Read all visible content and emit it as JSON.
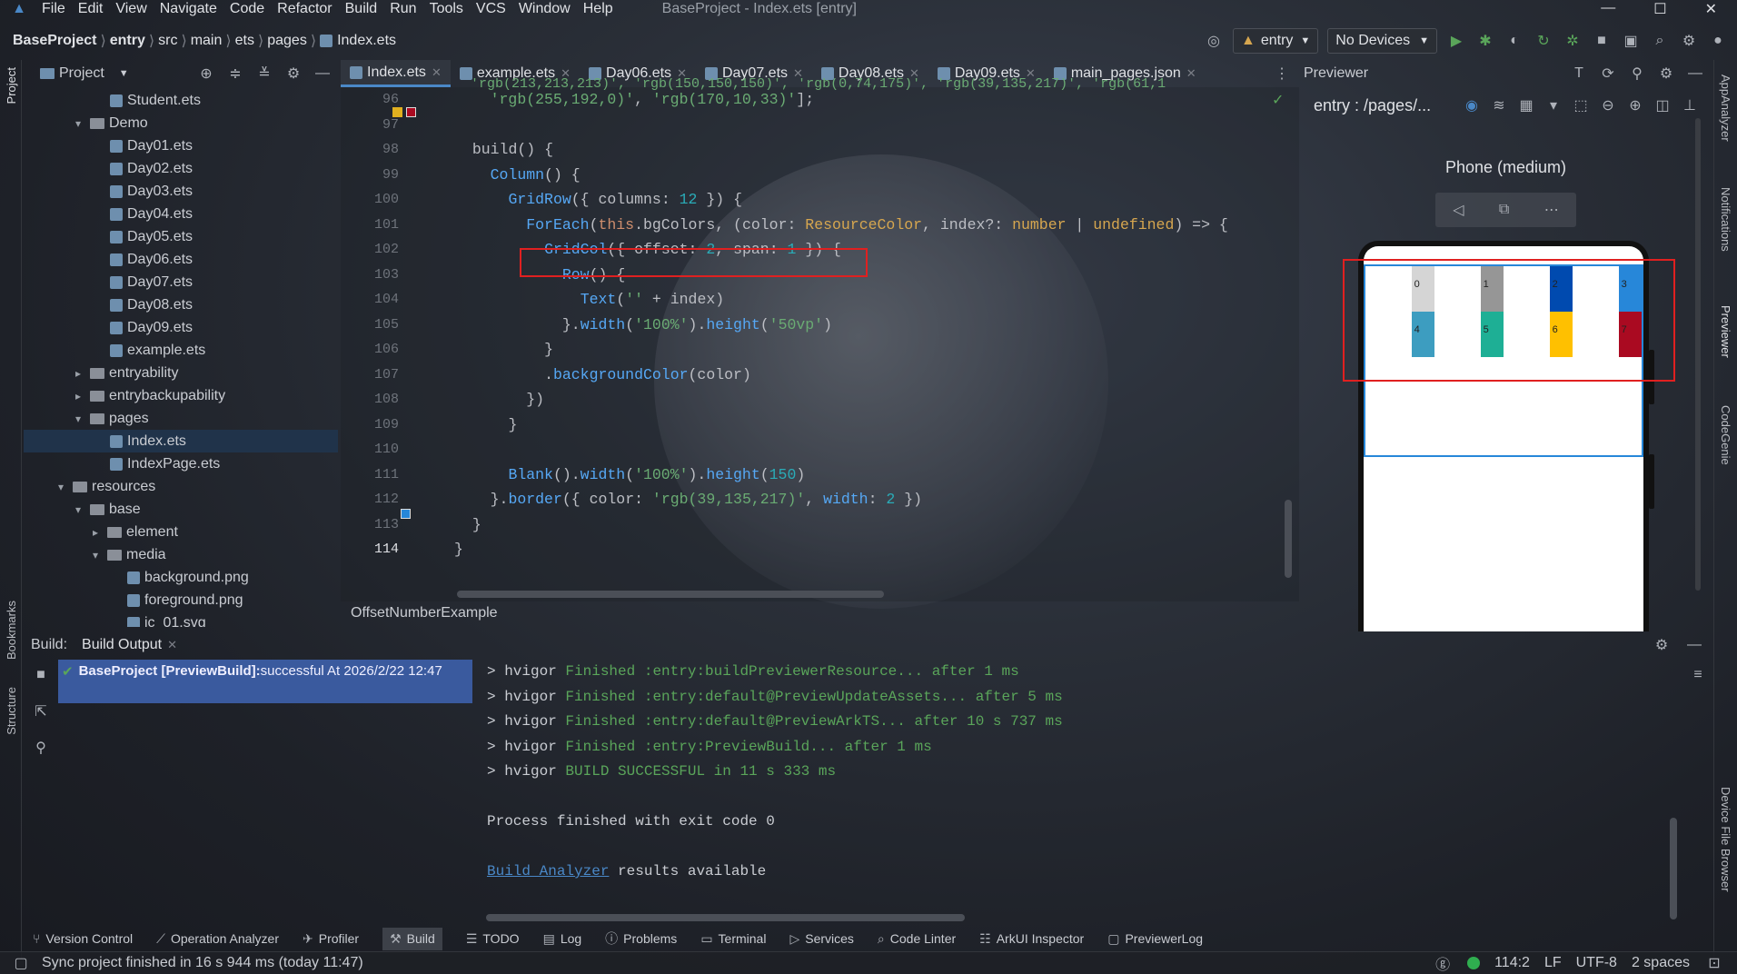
{
  "menu": [
    "File",
    "Edit",
    "View",
    "Navigate",
    "Code",
    "Refactor",
    "Build",
    "Run",
    "Tools",
    "VCS",
    "Window",
    "Help"
  ],
  "window_title": "BaseProject - Index.ets [entry]",
  "breadcrumb": [
    "BaseProject",
    "entry",
    "src",
    "main",
    "ets",
    "pages",
    "Index.ets"
  ],
  "toolbar": {
    "config": "entry",
    "devices": "No Devices"
  },
  "project": {
    "title": "Project",
    "tree": [
      {
        "label": "Student.ets",
        "indent": 7,
        "kind": "file"
      },
      {
        "label": "Demo",
        "indent": 5,
        "kind": "folder",
        "arrow": "v"
      },
      {
        "label": "Day01.ets",
        "indent": 7,
        "kind": "file"
      },
      {
        "label": "Day02.ets",
        "indent": 7,
        "kind": "file"
      },
      {
        "label": "Day03.ets",
        "indent": 7,
        "kind": "file"
      },
      {
        "label": "Day04.ets",
        "indent": 7,
        "kind": "file"
      },
      {
        "label": "Day05.ets",
        "indent": 7,
        "kind": "file"
      },
      {
        "label": "Day06.ets",
        "indent": 7,
        "kind": "file"
      },
      {
        "label": "Day07.ets",
        "indent": 7,
        "kind": "file"
      },
      {
        "label": "Day08.ets",
        "indent": 7,
        "kind": "file"
      },
      {
        "label": "Day09.ets",
        "indent": 7,
        "kind": "file"
      },
      {
        "label": "example.ets",
        "indent": 7,
        "kind": "file"
      },
      {
        "label": "entryability",
        "indent": 5,
        "kind": "folder",
        "arrow": ">"
      },
      {
        "label": "entrybackupability",
        "indent": 5,
        "kind": "folder",
        "arrow": ">"
      },
      {
        "label": "pages",
        "indent": 5,
        "kind": "folder",
        "arrow": "v"
      },
      {
        "label": "Index.ets",
        "indent": 7,
        "kind": "file",
        "selected": true
      },
      {
        "label": "IndexPage.ets",
        "indent": 7,
        "kind": "file"
      },
      {
        "label": "resources",
        "indent": 4,
        "kind": "folder",
        "arrow": "v"
      },
      {
        "label": "base",
        "indent": 5,
        "kind": "folder",
        "arrow": "v"
      },
      {
        "label": "element",
        "indent": 6,
        "kind": "folder",
        "arrow": ">"
      },
      {
        "label": "media",
        "indent": 6,
        "kind": "folder",
        "arrow": "v"
      },
      {
        "label": "background.png",
        "indent": 8,
        "kind": "file"
      },
      {
        "label": "foreground.png",
        "indent": 8,
        "kind": "file"
      },
      {
        "label": "ic_01.svg",
        "indent": 8,
        "kind": "file"
      }
    ]
  },
  "tabs": [
    "Index.ets",
    "example.ets",
    "Day06.ets",
    "Day07.ets",
    "Day08.ets",
    "Day09.ets",
    "main_pages.json"
  ],
  "line_numbers": [
    "96",
    "97",
    "98",
    "99",
    "100",
    "101",
    "102",
    "103",
    "104",
    "105",
    "106",
    "107",
    "108",
    "109",
    "110",
    "111",
    "112",
    "113",
    "114"
  ],
  "code_lines": [
    "    'rgb(255,192,0)', 'rgb(170,10,33)'];",
    "",
    "  build() {",
    "    Column() {",
    "      GridRow({ columns: 12 }) {",
    "        ForEach(this.bgColors, (color: ResourceColor, index?: number | undefined) => {",
    "          GridCol({ offset: 2, span: 1 }) {",
    "            Row() {",
    "              Text('' + index)",
    "            }.width('100%').height('50vp')",
    "          }",
    "          .backgroundColor(color)",
    "        })",
    "      }",
    "",
    "      Blank().width('100%').height(150)",
    "    }.border({ color: 'rgb(39,135,217)', width: 2 })",
    "  }",
    "}"
  ],
  "code_top_partial": "  'rgb(213,213,213)', 'rgb(150,150,150)', 'rgb(0,74,175)', 'rgb(39,135,217)', 'rgb(61,1",
  "code_breadcrumb": "OffsetNumberExample",
  "previewer": {
    "title": "Previewer",
    "path": "entry : /pages/...",
    "device": "Phone (medium)",
    "cells": [
      {
        "label": "0",
        "color": "#d5d5d5"
      },
      {
        "label": "1",
        "color": "#969696"
      },
      {
        "label": "2",
        "color": "#004aaf"
      },
      {
        "label": "3",
        "color": "#2787d9"
      },
      {
        "label": "4",
        "color": "#3d9dc0"
      },
      {
        "label": "5",
        "color": "#1eaf95"
      },
      {
        "label": "6",
        "color": "#ffc000"
      },
      {
        "label": "7",
        "color": "#aa0a21"
      }
    ]
  },
  "build": {
    "tab_label": "Build:",
    "tab": "Build Output",
    "status": "BaseProject [PreviewBuild]:",
    "status_detail": " successful At 2026/2/22 12:47",
    "console": [
      {
        "prefix": "> hvigor ",
        "text": "Finished :entry:buildPreviewerResource... after 1 ms",
        "color": "#5aa55a"
      },
      {
        "prefix": "> hvigor ",
        "text": "Finished :entry:default@PreviewUpdateAssets... after 5 ms",
        "color": "#5aa55a"
      },
      {
        "prefix": "> hvigor ",
        "text": "Finished :entry:default@PreviewArkTS... after 10 s 737 ms",
        "color": "#5aa55a"
      },
      {
        "prefix": "> hvigor ",
        "text": "Finished :entry:PreviewBuild... after 1 ms",
        "color": "#5aa55a"
      },
      {
        "prefix": "> hvigor ",
        "text": "BUILD SUCCESSFUL in 11 s 333 ms",
        "color": "#5aa55a"
      }
    ],
    "exit": "Process finished with exit code 0",
    "analyzer_link": "Build Analyzer",
    "analyzer_rest": " results available"
  },
  "toolwindows": [
    "Version Control",
    "Operation Analyzer",
    "Profiler",
    "Build",
    "TODO",
    "Log",
    "Problems",
    "Terminal",
    "Services",
    "Code Linter",
    "ArkUI Inspector",
    "PreviewerLog"
  ],
  "left_strip": [
    "Project",
    "Bookmarks",
    "Structure"
  ],
  "right_strip": [
    "AppAnalyzer",
    "Notifications",
    "Previewer",
    "CodeGenie",
    "Device File Browser"
  ],
  "status": {
    "message": "Sync project finished in 16 s 944 ms (today 11:47)",
    "position": "114:2",
    "line_sep": "LF",
    "encoding": "UTF-8",
    "indent": "2 spaces"
  }
}
